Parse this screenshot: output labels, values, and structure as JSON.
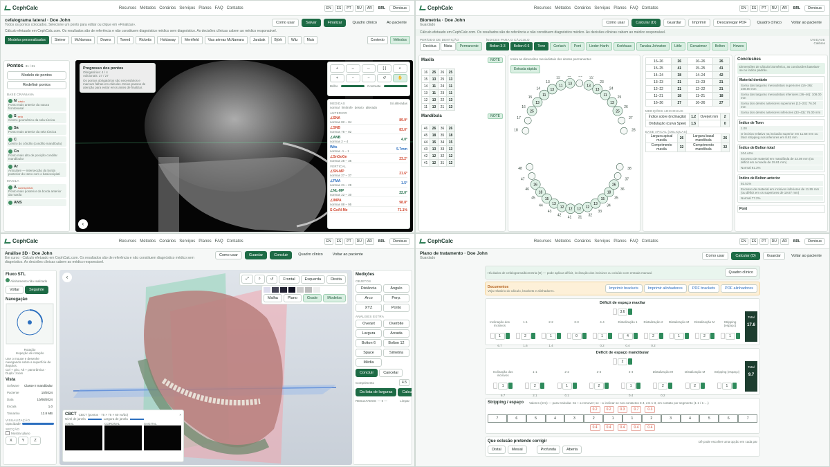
{
  "brand": "CephCalc",
  "nav": [
    "Recursos",
    "Métodos",
    "Cenários",
    "Serviços",
    "Planos",
    "FAQ",
    "Contatos"
  ],
  "langs": [
    "EN",
    "ES",
    "PT",
    "RU",
    "AR"
  ],
  "currency": "BRL",
  "user": "Denisus",
  "p1": {
    "title": "cefalograma lateral · Doe John",
    "subtitle": "Todos os pontos colocados. Selecione um ponto para editar ou clique em «Finalizar».",
    "btns": {
      "how": "Como usar",
      "save": "Salvar",
      "finish": "Finalizar",
      "clinical": "Quadro clínico",
      "patient": "Ao paciente"
    },
    "note": "Cálculo efetuado em CephCalc.com. Os resultados são de referência e não constituem diagnóstico médico sem diagnóstico. As decisões clínicas cabem ao médico responsável.",
    "methods": [
      "Modelos personalizados",
      "Steiner",
      "McNamara",
      "Downs",
      "Tweed",
      "Ricketts",
      "Holdaway",
      "Merrifield",
      "Vias aéreas McNamara",
      "Jarabak",
      "Björk",
      "Witz"
    ],
    "more": "Mais",
    "tabs": [
      "Contexto",
      "Métodos"
    ],
    "points_title": "Pontos",
    "points_count": "31 / 31",
    "points_btn1": "Modelo de pontos",
    "points_btn2": "Redefinir pontos",
    "points_section": "BASE CRANIANA",
    "points": [
      {
        "k": "N",
        "n": "násio",
        "d": "Ponto mais anterior da sutura frontonasal"
      },
      {
        "k": "S",
        "n": "sela",
        "d": "Centro geométrico da sela túrcica"
      },
      {
        "k": "Sa",
        "n": "",
        "d": "Ponto mais anterior da sela túrcica"
      },
      {
        "k": "C",
        "n": "",
        "d": "Centro do côndilo (condílio mandíbula)"
      },
      {
        "k": "Co",
        "n": "",
        "d": "Ponto mais alto de posição condilar mandibular"
      },
      {
        "k": "Ar",
        "n": "",
        "d": "Articulare — intersecção da borda posterior do ramo com o basioccipital"
      }
    ],
    "points_section2": "MAXILA",
    "points2": [
      {
        "k": "A",
        "n": "subespinhal",
        "d": "Ponto mais posterior da borda anterior da maxila"
      },
      {
        "k": "ANS",
        "n": "",
        "d": ""
      }
    ],
    "progress": {
      "title": "Progresso dos pontos",
      "line1": "Obrigatórios: 4 / 4",
      "line2": "Adicionais: 27 / 27",
      "desc": "Os pontos obrigatórios são necessários e marcam falhas em cálculos. Deixe passos de atenção para evitar erros antes de finalizar."
    },
    "tools": [
      "+",
      "↔",
      "↔",
      "[ ]",
      "◐",
      "+",
      "−",
      "−",
      "↺"
    ],
    "brightness": "Brilho",
    "contrast": "Contraste",
    "results_title": "MEDIDAS",
    "results_show": "Só alteradas",
    "results_legend": [
      "normal",
      "limítrofe",
      "desvio",
      "alterado"
    ],
    "results_section": "ANTERIOR",
    "results": [
      {
        "k": "∠SNA",
        "d": "normas 82 – 84",
        "v": "89.9°",
        "c": "#d0472f"
      },
      {
        "k": "∠SNB",
        "d": "normas 78 – 82",
        "v": "83.0°",
        "c": "#d0472f"
      },
      {
        "k": "∠ANB",
        "d": "normas 2 – 4",
        "v": "4.0°",
        "c": "#1d6b45"
      },
      {
        "k": "Wits",
        "d": "normas -1 – 1",
        "v": "5.7mm",
        "c": "#2c6fbf"
      },
      {
        "k": "∠SnGoGn",
        "d": "normas 28 – 36",
        "v": "23.2°",
        "c": "#d0472f"
      }
    ],
    "results_section2": "VERTICAL",
    "results2": [
      {
        "k": "∠SN-MP",
        "d": "normas 27 – 37",
        "v": "21.6°",
        "c": "#d0472f"
      },
      {
        "k": "∠FMA",
        "d": "normas 21 – 29",
        "v": "1.5°",
        "c": "#2c6fbf"
      },
      {
        "k": "∠NL-MP",
        "d": "normas 22 – 30",
        "v": "22.0°",
        "c": "#1d6b45"
      },
      {
        "k": "∠IMPA",
        "d": "normas 88 – 95",
        "v": "98.8°",
        "c": "#d0472f"
      },
      {
        "k": "S-Go/N-Me",
        "d": "",
        "v": "71.1%",
        "c": "#d0472f"
      }
    ]
  },
  "p2": {
    "title": "Biometria · Doe John",
    "subtitle": "Guardado",
    "btns": {
      "how": "Como usar",
      "calc": "Calcular (D)",
      "save": "Guardar",
      "print": "Imprimir",
      "pdf": "Descarregar PDF",
      "clinical": "Quadro clínico",
      "patient": "Voltar ao paciente"
    },
    "note": "Cálculo efetuado em CephCalc.com. Os resultados são de referência e não constituem diagnóstico médico. As decisões clínicas cabem ao médico responsável.",
    "dent_label": "PERÍODO DE DENTIÇÃO",
    "dent": [
      "Decídua",
      "Mista",
      "Permanente"
    ],
    "idx_label": "ÍNDICES PARA O CÁLCULO",
    "idx": [
      "Bolton 3-3",
      "Bolton 6-6",
      "Tonn",
      "Gerlach",
      "Pont",
      "Linder-Harth",
      "Korkhaus",
      "Tanaka-Johnston",
      "Little",
      "Gerasimov",
      "Bolton",
      "Howes"
    ],
    "units_label": "UNIDADE",
    "units": "Calibres",
    "hint": "Insira as dimensões mesiodistais dos dentes permanentes",
    "hint_btn": "Entrada rápida",
    "max_title": "Maxila",
    "mand_title": "Mandíbula",
    "note_btn": "NOTE",
    "max_rows": [
      [
        "16",
        "25",
        "26",
        "25"
      ],
      [
        "15",
        "13",
        "25",
        "13"
      ],
      [
        "14",
        "11",
        "24",
        "11"
      ],
      [
        "13",
        "11",
        "23",
        "11"
      ],
      [
        "12",
        "13",
        "22",
        "13"
      ],
      [
        "11",
        "13",
        "21",
        "13"
      ]
    ],
    "mand_rows": [
      [
        "46",
        "26",
        "36",
        "26"
      ],
      [
        "45",
        "18",
        "35",
        "18"
      ],
      [
        "44",
        "15",
        "34",
        "15"
      ],
      [
        "43",
        "13",
        "33",
        "13"
      ],
      [
        "42",
        "12",
        "32",
        "12"
      ],
      [
        "41",
        "12",
        "31",
        "12"
      ]
    ],
    "right_rows": [
      [
        "16–26",
        "26",
        "16–26",
        "26"
      ],
      [
        "15–25",
        "41",
        "15–25",
        "41"
      ],
      [
        "14–24",
        "38",
        "14–24",
        "42"
      ],
      [
        "13–23",
        "21",
        "13–23",
        "21"
      ],
      [
        "12–22",
        "21",
        "12–22",
        "21"
      ],
      [
        "11–21",
        "18",
        "11–21",
        "18"
      ],
      [
        "16–26",
        "27",
        "16–26",
        "27"
      ]
    ],
    "measures_title": "MEDIÇÕES ADICIONAIS",
    "measures": [
      [
        "Índice sobre (inclinação)",
        "1.2",
        "Overjet mm",
        "2"
      ],
      [
        "Ondulação (curva Spee)",
        "1.5",
        "",
        "0"
      ]
    ],
    "special_title": "BASE APICAL (OBLIQUAS)",
    "special": [
      [
        "Largura apical maxila",
        "26",
        "Largura basal mandíbula",
        "26"
      ],
      [
        "Comprimento maxila",
        "32",
        "Comprimento mandíbula",
        "32"
      ]
    ],
    "concl_title": "Conclusões",
    "concl_banner": "Dimensões de cálculo biométrico, as conclusões baseiam-se no índice padrão.",
    "concl_groups": [
      {
        "t": "Material dentário",
        "items": [
          "Soma das larguras mesiodistais superiores (16–26): 108.00 mm",
          "Soma das larguras mesiodistais inferiores (36–46): 108.00 mm",
          "Soma dos dentes anteriores superiores (13–23): 76.00 mm",
          "Soma dos dentes anteriores inferiores (33–43): 76.00 mm"
        ]
      },
      {
        "t": "Índice de Tonn",
        "items": [
          "1.00",
          "O incisivo relativo na inclusão superior em 11.58 mm ou fator stripping nos inferiores em 8.81 mm"
        ]
      },
      {
        "t": "Índice de Bolton total",
        "items": [
          "104.44%",
          "Excesso de material em mandíbula de 23.08 mm (ou déficit em a maxila de 29.81 mm)",
          "Normal 91.3%"
        ]
      },
      {
        "t": "Índice de Bolton anterior",
        "items": [
          "92.51%",
          "Excesso de material em incisivos inferiores de 11.55 mm (ou déficit em os superiores de 19.87 mm)",
          "Normal 77.2%"
        ]
      },
      {
        "t": "Pont",
        "items": []
      }
    ],
    "teeth_upper": [
      "18",
      "17",
      "16",
      "15",
      "14",
      "13",
      "12",
      "11",
      "21",
      "22",
      "23",
      "24",
      "25",
      "26",
      "27",
      "28"
    ],
    "teeth_lower": [
      "48",
      "47",
      "46",
      "45",
      "44",
      "43",
      "42",
      "41",
      "31",
      "32",
      "33",
      "34",
      "35",
      "36",
      "37",
      "38"
    ],
    "tooth_vals_upper": [
      "",
      "",
      "25",
      "13",
      "11",
      "13",
      "11",
      "13",
      "",
      "13",
      "13",
      "11",
      "13",
      "25",
      "",
      ""
    ],
    "tooth_vals_lower": [
      "",
      "",
      "26",
      "18",
      "15",
      "13",
      "12",
      "12",
      "12",
      "12",
      "13",
      "15",
      "18",
      "26",
      "",
      ""
    ]
  },
  "p3": {
    "title": "Análise 3D · Doe John",
    "subtitle": "Em curso · Cálculo efetuado em CephCalc.com. Os resultados são de referência e não constituem diagnóstico médico sem diagnóstico. As decisões clínicas cabem ao médico responsável.",
    "btns": {
      "how": "Como usar",
      "save": "Guardar",
      "finish": "Concluir",
      "clinical": "Quadro clínico",
      "patient": "Voltar ao paciente"
    },
    "stl_title": "Fluxo STL",
    "stl_sub": "Alinhamento não realizado",
    "stl_steps": [
      "Voltar",
      "Seguinte"
    ],
    "nav_title": "Navegação",
    "nav_hint": "Rotação",
    "nav_hint2": "Inspeção de rotação",
    "nav_desc": "Use o mouse e desenhe navegando sobre a superfície de ângulos.",
    "nav_desc2": "Ctrl + giro, Alt + panorâmica · Duplo: zoom",
    "view_title": "Vista",
    "view_rows": [
      [
        "Software",
        "Classe II mandibular"
      ],
      [
        "Paciente",
        "10/2024"
      ],
      [
        "Data",
        "10/08/2024"
      ],
      [
        "Escala",
        "1.0"
      ],
      [
        "Tamanho",
        "12.8 MB"
      ]
    ],
    "vis_title": "VISUALIZAÇÃO",
    "vis_opacity": "Opacidade",
    "section_title": "SECÇÃO",
    "section_show": "Mostrar plano",
    "section_axes": [
      "X",
      "Y",
      "Z"
    ],
    "view_btns": [
      "Frontal",
      "Esquerda",
      "Direita"
    ],
    "render_modes": [
      "Malha",
      "Plano",
      "Grade",
      "Modelos"
    ],
    "cbct_title": "CBCT",
    "cbct_sub": "CBCT (pontos · 75 × 75 × 60 vo/do)",
    "cbct_level": "Nível de janela",
    "cbct_width": "Largura de janela",
    "cbct_views": [
      "AXIAL",
      "CORONAL",
      "SAGITAL"
    ],
    "meas_title": "Medições",
    "meas_grid_label": "OBJETOS",
    "meas_grid": [
      "Distância",
      "Ângulo",
      "Arco",
      "Perp.",
      "XYZ",
      "Ponto"
    ],
    "meas_grid_label2": "ANÁLISES EXTRA",
    "meas_grid2": [
      "Overjet",
      "Overbite",
      "Largura",
      "Arcada",
      "Bolton 6",
      "Bolton 12",
      "Space",
      "Simetria",
      "Média",
      ""
    ],
    "meas_btns": [
      "Concluir",
      "Cancelar"
    ],
    "meas_small": "Comprimento",
    "meas_val": "4.5",
    "meas_calc": [
      "Da lista de larguras",
      "Calcular"
    ],
    "meas_result": "RESULTADOS",
    "meas_res_val": "— 0 —",
    "meas_clear": "Limpar"
  },
  "p4": {
    "title": "Plano de tratamento · Doe John",
    "subtitle": "Guardado",
    "btns": {
      "how": "Como usar",
      "calc": "Calcular (D)",
      "save": "Guardar",
      "patient": "Voltar ao paciente"
    },
    "info": "Há dados de cefalograma/biometria (D) — pode aplicar déficit, inclinação dos incisivos ou ocluído com entrada manual.",
    "info_btn": "Quadro clínico",
    "doc_title": "Documentos",
    "doc_sub": "Veja relatório do cálculo, brackets e alinhadores.",
    "doc_btns": [
      "Imprimir brackets",
      "Imprimir alinhadores",
      "PDF brackets",
      "PDF alinhadores"
    ],
    "max_title": "Déficit de espaço maxilar",
    "max_val": "3.6",
    "max_cols": [
      "Inclinação dos incisivos",
      "1-1",
      "2-2",
      "3-3",
      "4-4",
      "Distalização 1",
      "Distalização 2",
      "Distalização M",
      "Distalização M",
      "Stripping (espaço)"
    ],
    "max_vals": [
      "1",
      "2",
      "1",
      "0",
      "1",
      "4",
      "2",
      "1",
      "2",
      "1"
    ],
    "max_sub": [
      "6.7",
      "1.6",
      "1.4",
      "",
      "0.2",
      "0.4",
      "0.2",
      "",
      "",
      ""
    ],
    "max_total_label": "Total",
    "max_total": "17.6",
    "mand_title": "Déficit de espaço mandibular",
    "mand_val": "2",
    "mand_cols": [
      "Inclinação dos incisivos",
      "1-1",
      "2-2",
      "3-3",
      "4-4",
      "Distalização M",
      "Distalização M",
      "Stripping (espaço)"
    ],
    "mand_vals": [
      "1",
      "2",
      "1",
      "2",
      "1",
      "2",
      "2",
      "1"
    ],
    "mand_sub": [
      "6.7",
      "2.1",
      "0.1",
      "",
      "0.4",
      "0.2",
      "",
      ""
    ],
    "mand_total_label": "Total",
    "mand_total": "9.7",
    "strip_title": "Stripping / espaço",
    "strip_hint": "Valores (mm) — para Calcular. Se + ≥ remover; se – ≥ inclinar se nos contactos 3-4, em 1-3, em contato por segmento (1-1 / 1-…)",
    "strip_top": [
      "0.2",
      "0.2",
      "0.3",
      "0.7",
      "0.3"
    ],
    "strip_teeth": [
      "7",
      "6",
      "5",
      "4",
      "3",
      "2",
      "1",
      "1",
      "2",
      "3",
      "4",
      "5",
      "6",
      "7"
    ],
    "strip_bot": [
      "0.4",
      "0.4",
      "0.4",
      "0.4",
      "0.4"
    ],
    "occl_title": "Que oclusão pretende corrigir",
    "occl_hint": "Dê pode escolher uma opção em cada par",
    "occl_a": [
      "Distal",
      "Mesial"
    ],
    "occl_b": [
      "Profunda",
      "Aberta"
    ]
  },
  "colors": {
    "accent": "#1d6b45",
    "accent_light": "#d9efe2",
    "danger": "#d0472f",
    "info": "#2c6fbf",
    "warn": "#fdf0d8"
  }
}
